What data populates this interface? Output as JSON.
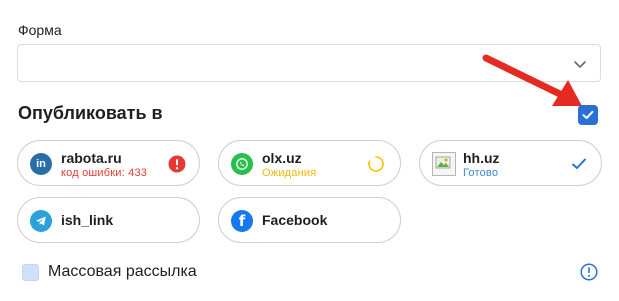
{
  "form": {
    "label": "Форма",
    "value": ""
  },
  "publish": {
    "title": "Опубликовать в",
    "select_all_checked": true
  },
  "platforms": [
    {
      "name": "rabota.ru",
      "status": "код ошибки: 433",
      "status_color": "#e53935",
      "logo_color": "#2a6ea8",
      "logo": "linkedin-icon",
      "state": "error"
    },
    {
      "name": "olx.uz",
      "status": "Ожидания",
      "status_color": "#f2b705",
      "logo_color": "#25c14b",
      "logo": "whatsapp-icon",
      "state": "pending"
    },
    {
      "name": "hh.uz",
      "status": "Готово",
      "status_color": "#3f86d8",
      "logo": "broken-image-icon",
      "state": "done"
    },
    {
      "name": "ish_link",
      "status": "",
      "logo_color": "#2aa1dc",
      "logo": "telegram-icon",
      "state": "none"
    },
    {
      "name": "Facebook",
      "status": "",
      "logo_color": "#1877f2",
      "logo": "facebook-icon",
      "state": "none"
    }
  ],
  "mass_mailing": {
    "label": "Массовая рассылка",
    "checked": false
  },
  "colors": {
    "accent": "#2a6fd4",
    "arrow": "#e52a24",
    "border": "#cfcfcf"
  }
}
